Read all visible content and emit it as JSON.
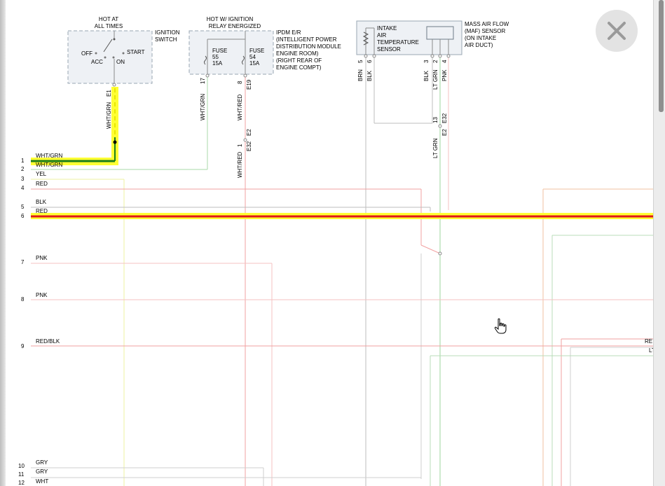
{
  "title": "",
  "components": {
    "hot_at_all_times": [
      "HOT AT",
      "ALL TIMES"
    ],
    "ignition_switch": [
      "IGNITION",
      "SWITCH"
    ],
    "switch_positions": {
      "off": "OFF",
      "acc": "ACC",
      "on": "ON",
      "start": "START"
    },
    "hot_w_ignition": [
      "HOT W/ IGNITION",
      "RELAY ENERGIZED"
    ],
    "fuse_55": [
      "FUSE",
      "55",
      "15A"
    ],
    "fuse_54": [
      "FUSE",
      "54",
      "15A"
    ],
    "ipdm": [
      "IPDM E/R",
      "(INTELLIGENT POWER",
      "DISTRIBUTION MODULE",
      "ENGINE ROOM)",
      "(RIGHT REAR OF",
      "ENGINE COMPT)"
    ],
    "iat_sensor": [
      "INTAKE",
      "AIR",
      "TEMPERATURE",
      "SENSOR"
    ],
    "maf_sensor": [
      "MASS AIR FLOW",
      "(MAF) SENSOR",
      "(ON INTAKE",
      "AIR DUCT)"
    ]
  },
  "vertical_labels": {
    "ign_wire": "WHT/GRN",
    "ign_connector": "E1",
    "fuse55_pin": "17",
    "fuse55_wire": "WHT/GRN",
    "fuse54_pin": "8",
    "fuse54_wire": "WHT/RED",
    "fuse54_connector": "E19",
    "e2_upper": "E2",
    "e32_pin": "1",
    "e32_connector": "E32",
    "wht_red_lower": "WHT/RED",
    "iat_pin5": "5",
    "iat_wire5": "BRN",
    "iat_pin6": "6",
    "iat_wire6": "BLK",
    "maf_pin3": "3",
    "maf_wire3": "BLK",
    "maf_pin2": "2",
    "maf_wire2": "LT GRN",
    "maf_pin4": "4",
    "maf_wire4": "PNK",
    "e32_pin13": "13",
    "e32_right": "E32",
    "e2_right": "E2",
    "lt_grn_lower": "LT GRN"
  },
  "rows": [
    {
      "num": "1",
      "wire": "WHT/GRN"
    },
    {
      "num": "2",
      "wire": "WHT/GRN"
    },
    {
      "num": "3",
      "wire": "YEL"
    },
    {
      "num": "4",
      "wire": "RED"
    },
    {
      "num": "5",
      "wire": "BLK"
    },
    {
      "num": "6",
      "wire": "RED"
    },
    {
      "num": "7",
      "wire": "PNK"
    },
    {
      "num": "8",
      "wire": "PNK"
    },
    {
      "num": "9",
      "wire": "RED/BLK"
    },
    {
      "num": "10",
      "wire": "GRY"
    },
    {
      "num": "11",
      "wire": "GRY"
    },
    {
      "num": "12",
      "wire": "WHT"
    }
  ],
  "right_edge_labels": [
    "RE",
    "LT"
  ],
  "colors": {
    "highlight": "#ffff33",
    "wire_green": "#1a7d1a",
    "wire_red": "#e01818",
    "light_red": "#f5a6a6",
    "light_green": "#9ed69e",
    "light_yellow": "#eef2a0",
    "light_gray": "#bdbdbd",
    "light_pink": "#f4c2c2",
    "component_border": "#9aa7b3"
  },
  "close_icon": "close-x-icon",
  "cursor_icon": "hand-pointer-icon"
}
